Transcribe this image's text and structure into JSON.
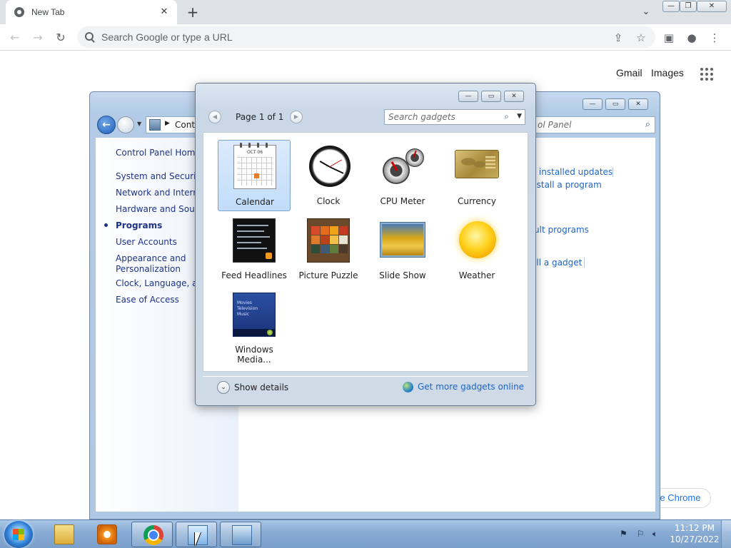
{
  "browser": {
    "tab_title": "New Tab",
    "tab_close": "✕",
    "new_tab": "+",
    "tab_search": "⌄",
    "omnibox_placeholder": "Search Google or type a URL",
    "window_controls": {
      "minimize": "—",
      "restore": "❐",
      "close": "✕"
    },
    "icons": [
      "back-icon",
      "forward-icon",
      "reload-icon",
      "search-icon",
      "share-icon",
      "star-icon",
      "side-panel-icon",
      "profile-icon",
      "menu-icon"
    ]
  },
  "ntp": {
    "gmail": "Gmail",
    "images": "Images",
    "customize": "ize Chrome"
  },
  "control_panel": {
    "breadcrumb": "Contr",
    "search_placeholder": "ol Panel",
    "left_nav": [
      {
        "label": "Control Panel Home"
      },
      {
        "label": "System and Security"
      },
      {
        "label": "Network and Internet"
      },
      {
        "label": "Hardware and Sound"
      },
      {
        "label": "Programs"
      },
      {
        "label": "User Accounts"
      },
      {
        "label": "Appearance and Personalization"
      },
      {
        "label": "Clock, Language, and"
      },
      {
        "label": "Ease of Access"
      }
    ],
    "right_links": [
      {
        "label": "v installed updates"
      },
      {
        "label": "nstall a program"
      },
      {
        "label": "ult programs"
      },
      {
        "label": "all a gadget"
      }
    ]
  },
  "gadgets_window": {
    "page_label": "Page 1 of 1",
    "search_placeholder": "Search gadgets",
    "items": [
      {
        "label": "Calendar",
        "selected": true
      },
      {
        "label": "Clock"
      },
      {
        "label": "CPU Meter"
      },
      {
        "label": "Currency"
      },
      {
        "label": "Feed Headlines"
      },
      {
        "label": "Picture Puzzle"
      },
      {
        "label": "Slide Show"
      },
      {
        "label": "Weather"
      },
      {
        "label": "Windows Media..."
      }
    ],
    "show_details": "Show details",
    "get_more": "Get more gadgets online",
    "calendar_month": "OCT 06"
  },
  "taskbar": {
    "time": "11:12 PM",
    "date": "10/27/2022",
    "items": [
      "start-button",
      "explorer",
      "media-player",
      "chrome",
      "gadgets",
      "control-panel"
    ]
  },
  "colors": {
    "link": "#1e64c8",
    "cp_link": "#1e3287",
    "chrome_toolbar": "#dee1e6"
  }
}
